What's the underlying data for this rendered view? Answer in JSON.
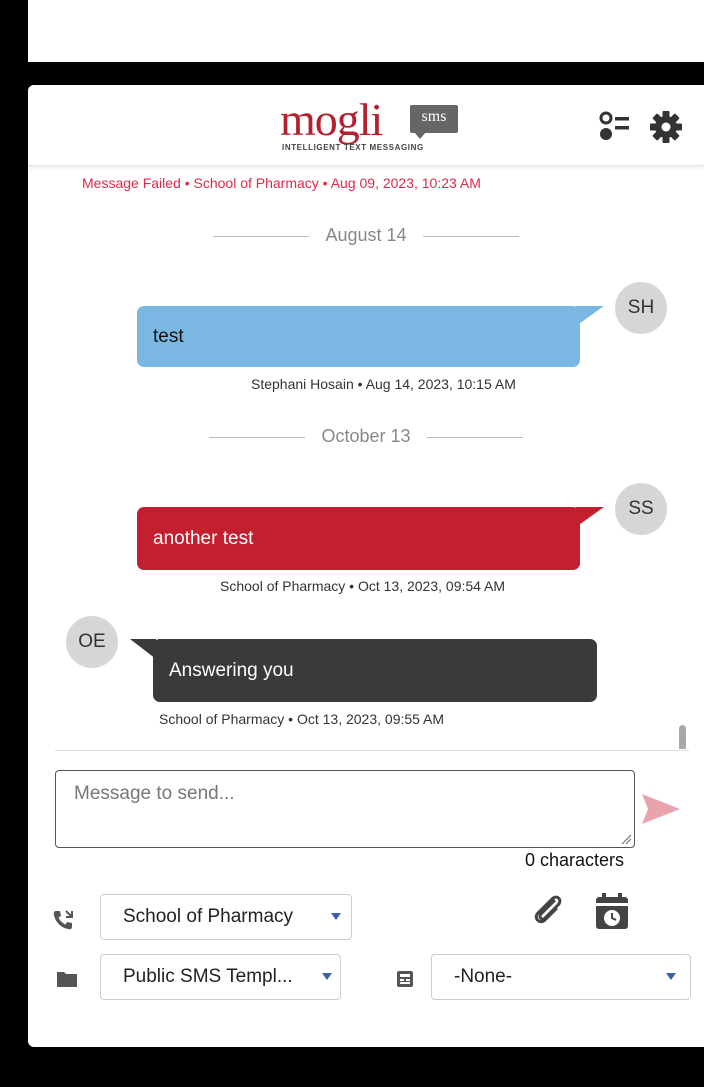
{
  "header": {
    "logo_text": "mogli",
    "logo_badge": "sms",
    "logo_tagline": "INTELLIGENT TEXT MESSAGING"
  },
  "conversation": {
    "failed_status": "Message Failed • School of Pharmacy • Aug 09, 2023, 10:23 AM",
    "dates": [
      "August 14",
      "October 13"
    ],
    "messages": [
      {
        "direction": "outgoing",
        "initials": "SH",
        "text": "test",
        "meta": "Stephani Hosain • Aug 14, 2023, 10:15 AM",
        "color": "#7ab8e3"
      },
      {
        "direction": "outgoing",
        "initials": "SS",
        "text": "another test",
        "meta": "School of Pharmacy • Oct 13, 2023, 09:54 AM",
        "color": "#c31f2f"
      },
      {
        "direction": "incoming",
        "initials": "OE",
        "text": "Answering you",
        "meta": "School of Pharmacy • Oct 13, 2023, 09:55 AM",
        "color": "#3a3a3a"
      }
    ]
  },
  "composer": {
    "placeholder": "Message to send...",
    "value": "",
    "char_count": "0 characters"
  },
  "options": {
    "from_number": "School of Pharmacy",
    "template": "Public SMS Templ...",
    "template_item": "-None-"
  },
  "colors": {
    "brand": "#b5202e",
    "error": "#e0294a",
    "send_icon": "#e8a3ad",
    "caret": "#3a5ea8"
  },
  "icons": [
    "user-list-icon",
    "gear-icon",
    "phone-icon",
    "paperclip-icon",
    "scheduled-calendar-icon",
    "folder-icon",
    "template-icon",
    "send-icon"
  ]
}
